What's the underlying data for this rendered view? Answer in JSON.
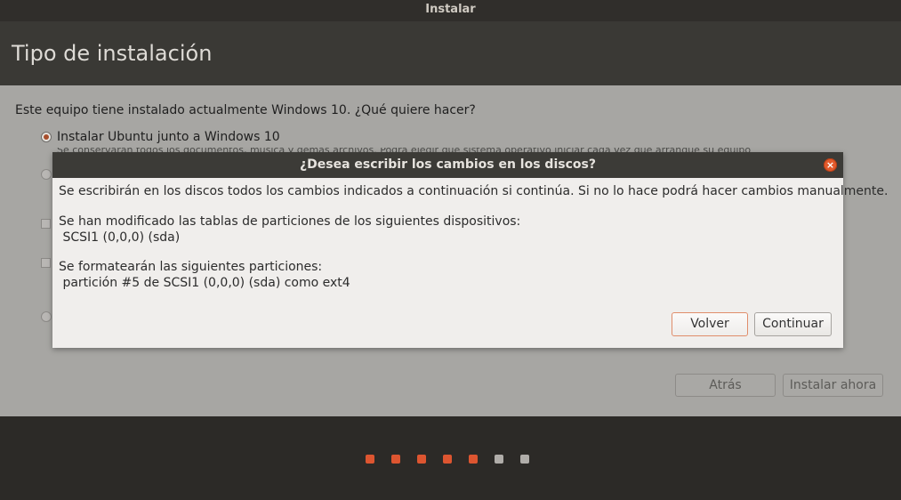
{
  "window": {
    "title": "Instalar"
  },
  "header": {
    "title": "Tipo de instalación"
  },
  "main": {
    "question": "Este equipo tiene instalado actualmente Windows 10. ¿Qué quiere hacer?",
    "option1_label": "Instalar Ubuntu junto a Windows 10",
    "option1_desc": "Se conservarán todos los documentos, música y demás archivos. Podrá elegir qué sistema operativo iniciar cada vez que arranque su equipo."
  },
  "buttons": {
    "back": "Atrás",
    "install_now": "Instalar ahora"
  },
  "dialog": {
    "title": "¿Desea escribir los cambios en los discos?",
    "close_glyph": "×",
    "line1": "Se escribirán en los discos todos los cambios indicados a continuación si continúa. Si no lo hace podrá hacer cambios manualmente.",
    "line2": "Se han modificado las tablas de particiones de los siguientes dispositivos:",
    "line3": " SCSI1 (0,0,0) (sda)",
    "line4": "Se formatearán las siguientes particiones:",
    "line5": " partición #5 de SCSI1 (0,0,0) (sda) como ext4",
    "back_button": "Volver",
    "continue_button": "Continuar"
  },
  "progress": {
    "total_steps": 7,
    "completed_steps": 5
  },
  "colors": {
    "accent": "#e05a2b",
    "dot_done": "#dd5530",
    "dot_pending": "#b0ada9"
  }
}
